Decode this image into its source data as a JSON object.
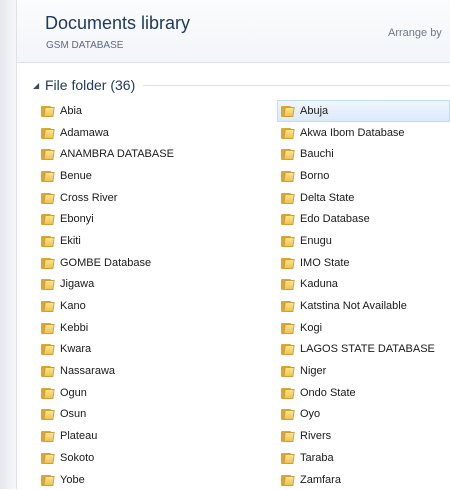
{
  "library": {
    "title": "Documents library",
    "subtitle": "GSM DATABASE",
    "arrange_by": "Arrange by"
  },
  "group": {
    "label": "File folder (36)"
  },
  "folders": [
    "Abia",
    "Abuja",
    "Adamawa",
    "Akwa Ibom Database",
    "ANAMBRA DATABASE",
    "Bauchi",
    "Benue",
    "Borno",
    "Cross River",
    "Delta State",
    "Ebonyi",
    "Edo Database",
    "Ekiti",
    "Enugu",
    "GOMBE Database",
    "IMO State",
    "Jigawa",
    "Kaduna",
    "Kano",
    "Katstina Not Available",
    "Kebbi",
    "Kogi",
    "Kwara",
    "LAGOS STATE DATABASE",
    "Nassarawa",
    "Niger",
    "Ogun",
    "Ondo State",
    "Osun",
    "Oyo",
    "Plateau",
    "Rivers",
    "Sokoto",
    "Taraba",
    "Yobe",
    "Zamfara"
  ],
  "selected_folder": "Abuja",
  "icons": {
    "folder": "folder-icon",
    "collapse": "collapse-arrow-icon"
  },
  "colors": {
    "title": "#1e395b",
    "selection": "#dbeafb",
    "folder": "#f2c14e"
  }
}
